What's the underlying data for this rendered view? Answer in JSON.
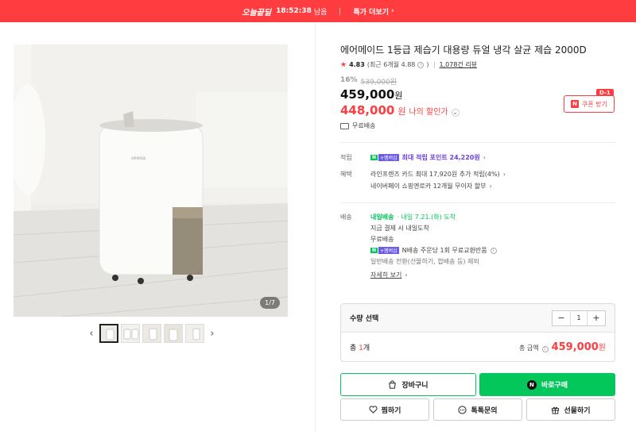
{
  "deal_bar": {
    "badge": "오늘끝딜",
    "timer": "18:52:38",
    "remaining": "남음",
    "more": "특가 더보기"
  },
  "gallery": {
    "page_counter": "1/7",
    "brand_on_product": "AIRMADE"
  },
  "product": {
    "title": "에어메이드 1등급 제습기 대용량 듀얼 냉각 살균 제습 2000D",
    "rating": "4.83",
    "recent_rating": "(최근 6개월 4.88",
    "review_count": "1,078건 리뷰",
    "discount_pct": "16%",
    "original_price": "539,000원",
    "price": "459,000",
    "sale_price": "448,000",
    "won": "원",
    "sale_label": "나의 할인가",
    "shipping_free": "무료배송"
  },
  "coupon": {
    "dday": "D-1",
    "label": "쿠폰 받기"
  },
  "benefits": {
    "points_label": "적립",
    "points_text": "최대 적립 포인트 24,220원",
    "benefit_label": "혜택",
    "benefit_line1": "라인프렌즈 카드 최대 17,920원 추가 적립(4%)",
    "benefit_line2": "네이버페이 쇼핑엔로카 12개월 무이자 할부"
  },
  "delivery": {
    "label": "배송",
    "tag": "내일배송",
    "date": "· 내일 7.21.(화) 도착",
    "line1": "지금 결제 시 내일도착",
    "line2": "무료배송",
    "line3": "N배송 주문당 1회 무료교환반품",
    "line4": "일반배송 전환(선물하기, 합배송 등) 제외",
    "details": "자세히 보기"
  },
  "quantity": {
    "label": "수량 선택",
    "value": "1",
    "total_count_prefix": "총 ",
    "total_count": "1",
    "total_count_suffix": "개",
    "total_label": "총 금액",
    "total_amount": "459,000"
  },
  "actions": {
    "cart": "장바구니",
    "buy": "바로구매",
    "wish": "찜하기",
    "talk": "톡톡문의",
    "gift": "선물하기"
  }
}
